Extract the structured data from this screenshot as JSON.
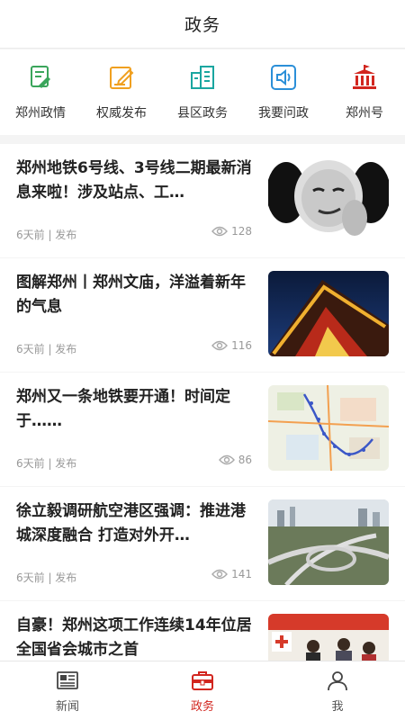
{
  "header": {
    "title": "政务"
  },
  "quicknav": [
    {
      "label": "郑州政情",
      "icon": "pen-document-icon",
      "color": "#3aa55b"
    },
    {
      "label": "权威发布",
      "icon": "edit-square-icon",
      "color": "#f0a020"
    },
    {
      "label": "县区政务",
      "icon": "building-doc-icon",
      "color": "#1aa6a0"
    },
    {
      "label": "我要问政",
      "icon": "speaker-icon",
      "color": "#2b8fd8"
    },
    {
      "label": "郑州号",
      "icon": "government-building-icon",
      "color": "#d2261f"
    }
  ],
  "feed": [
    {
      "title": "郑州地铁6号线、3号线二期最新消息来啦！涉及站点、工…",
      "meta": "6天前 | 发布",
      "views": "128"
    },
    {
      "title": "图解郑州丨郑州文庙，洋溢着新年的气息",
      "meta": "6天前 | 发布",
      "views": "116"
    },
    {
      "title": "郑州又一条地铁要开通！时间定于……",
      "meta": "6天前 | 发布",
      "views": "86"
    },
    {
      "title": "徐立毅调研航空港区强调：推进港城深度融合 打造对外开…",
      "meta": "6天前 | 发布",
      "views": "141"
    },
    {
      "title": "自豪！郑州这项工作连续14年位居全国省会城市之首",
      "meta": "",
      "views": ""
    }
  ],
  "tabbar": [
    {
      "label": "新闻",
      "icon": "newspaper-icon",
      "active": false
    },
    {
      "label": "政务",
      "icon": "briefcase-icon",
      "active": true
    },
    {
      "label": "我",
      "icon": "person-icon",
      "active": false
    }
  ],
  "colors": {
    "accent": "#d2261f",
    "muted": "#999999"
  }
}
